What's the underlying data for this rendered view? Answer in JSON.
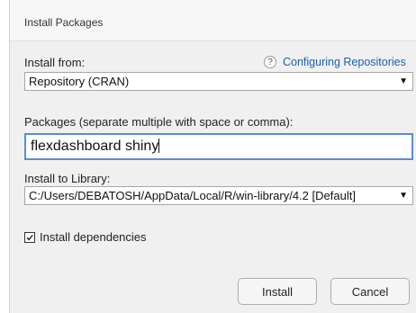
{
  "dialog": {
    "title": "Install Packages",
    "install_from_label": "Install from:",
    "help_link": "Configuring Repositories",
    "help_icon": "?",
    "repository_value": "Repository (CRAN)",
    "packages_label": "Packages (separate multiple with space or comma):",
    "packages_value": "flexdashboard shiny",
    "library_label": "Install to Library:",
    "library_value": "C:/Users/DEBATOSH/AppData/Local/R/win-library/4.2 [Default]",
    "dependencies_label": "Install dependencies",
    "dependencies_checked": true,
    "install_button": "Install",
    "cancel_button": "Cancel"
  },
  "icons": [
    "help-icon",
    "dropdown-arrow-icon",
    "checkmark-icon"
  ],
  "colors": {
    "accent": "#5b8bd6",
    "link": "#1a5fb4",
    "dialog_bg": "#f0f0f0"
  }
}
